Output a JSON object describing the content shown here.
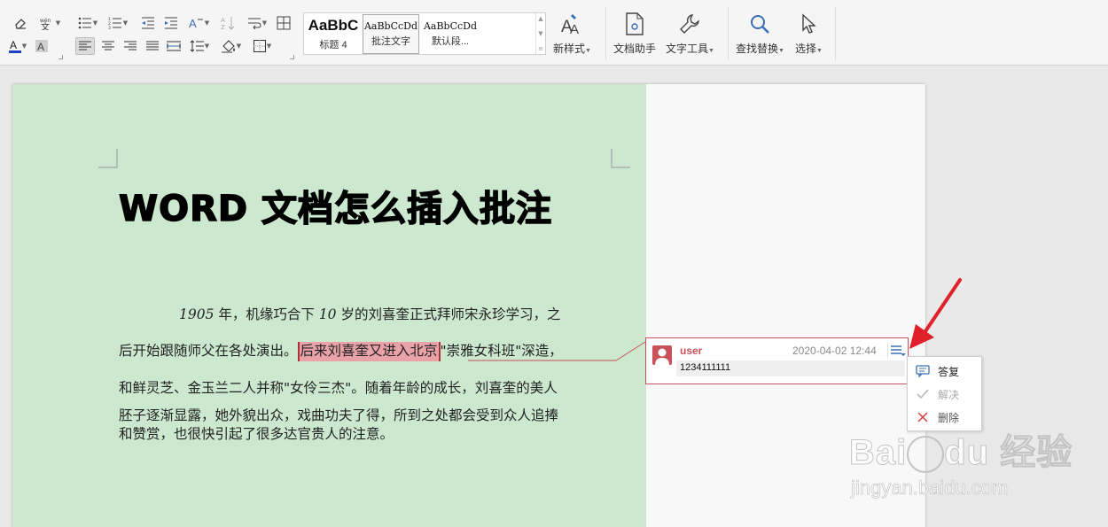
{
  "ribbon": {
    "styles": [
      {
        "preview": "AaBbC",
        "name": "标题 4"
      },
      {
        "preview": "AaBbCcDd",
        "name": "批注文字"
      },
      {
        "preview": "AaBbCcDd",
        "name": "默认段..."
      }
    ],
    "buttons": {
      "new_style": "新样式",
      "doc_assistant": "文档助手",
      "text_tools": "文字工具",
      "find_replace": "查找替换",
      "select": "选择"
    }
  },
  "document": {
    "title": "WORD 文档怎么插入批注",
    "para_num1": "1905",
    "para_line1_a": " 年，机缘巧合下 ",
    "para_num2": "10",
    "para_line1_b": " 岁的刘喜奎正式拜师宋永珍学习，之",
    "para_line2_before": "后开始跟随师父在各处演出。",
    "para_line2_highlight": "后来刘喜奎又进入北京",
    "para_line2_after": "\"崇雅女科班\"深造，",
    "para_line3": "和鲜灵芝、金玉兰二人并称\"女伶三杰\"。随着年龄的成长，刘喜奎的美人",
    "para_line4": "胚子逐渐显露，她外貌出众，戏曲功夫了得，所到之处都会受到众人追捧",
    "para_line5": "和赞赏，也很快引起了很多达官贵人的注意。"
  },
  "comment": {
    "user": "user",
    "timestamp": "2020-04-02 12:44",
    "text": "1234111111",
    "menu": [
      {
        "label": "答复",
        "enabled": true
      },
      {
        "label": "解决",
        "enabled": false
      },
      {
        "label": "删除",
        "enabled": true
      }
    ]
  },
  "watermark": {
    "url": "jingyan.baidu.com"
  },
  "colors": {
    "page_bg": "#cce8cf",
    "comment_accent": "#c9525a",
    "highlight": "#e8a2a8",
    "arrow": "#e0202a"
  }
}
